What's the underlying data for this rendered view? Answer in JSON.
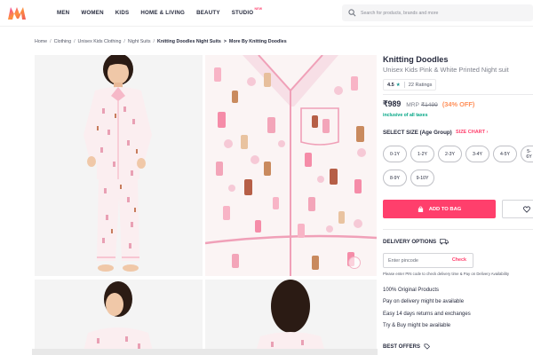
{
  "header": {
    "logo": "myntra-logo",
    "nav": [
      "MEN",
      "WOMEN",
      "KIDS",
      "HOME & LIVING",
      "BEAUTY",
      "STUDIO"
    ],
    "studio_badge": "NEW",
    "search_placeholder": "Search for products, brands and more",
    "colors": {
      "accent": "#ff3f6c",
      "brand_orange": "#f13ab1"
    }
  },
  "breadcrumb": [
    "Home",
    "Clothing",
    "Unisex Kids Clothing",
    "Night Suits",
    "Knitting Doodles Night Suits",
    "More By Knitting Doodles"
  ],
  "product": {
    "brand": "Knitting Doodles",
    "name": "Unisex Kids Pink & White Printed Night suit",
    "rating": "4.5",
    "ratings_count": "22 Ratings",
    "price": "₹989",
    "mrp_label": "MRP",
    "mrp": "₹1499",
    "discount": "(34% OFF)",
    "taxes": "inclusive of all taxes"
  },
  "sizes": {
    "title": "SELECT SIZE (Age Group)",
    "chart_link": "SIZE CHART ›",
    "options": [
      "0-1Y",
      "1-2Y",
      "2-3Y",
      "3-4Y",
      "4-5Y",
      "5-6Y",
      "8-9Y",
      "9-10Y"
    ]
  },
  "actions": {
    "add_to_bag": "ADD TO BAG",
    "wishlist_icon": "heart-icon"
  },
  "delivery": {
    "title": "DELIVERY OPTIONS",
    "pin_placeholder": "Enter pincode",
    "check": "Check",
    "note": "Please enter PIN code to check delivery time & Pay on Delivery Availability",
    "features": [
      "100% Original Products",
      "Pay on delivery might be available",
      "Easy 14 days returns and exchanges",
      "Try & Buy might be available"
    ]
  },
  "offers": {
    "title": "BEST OFFERS"
  }
}
